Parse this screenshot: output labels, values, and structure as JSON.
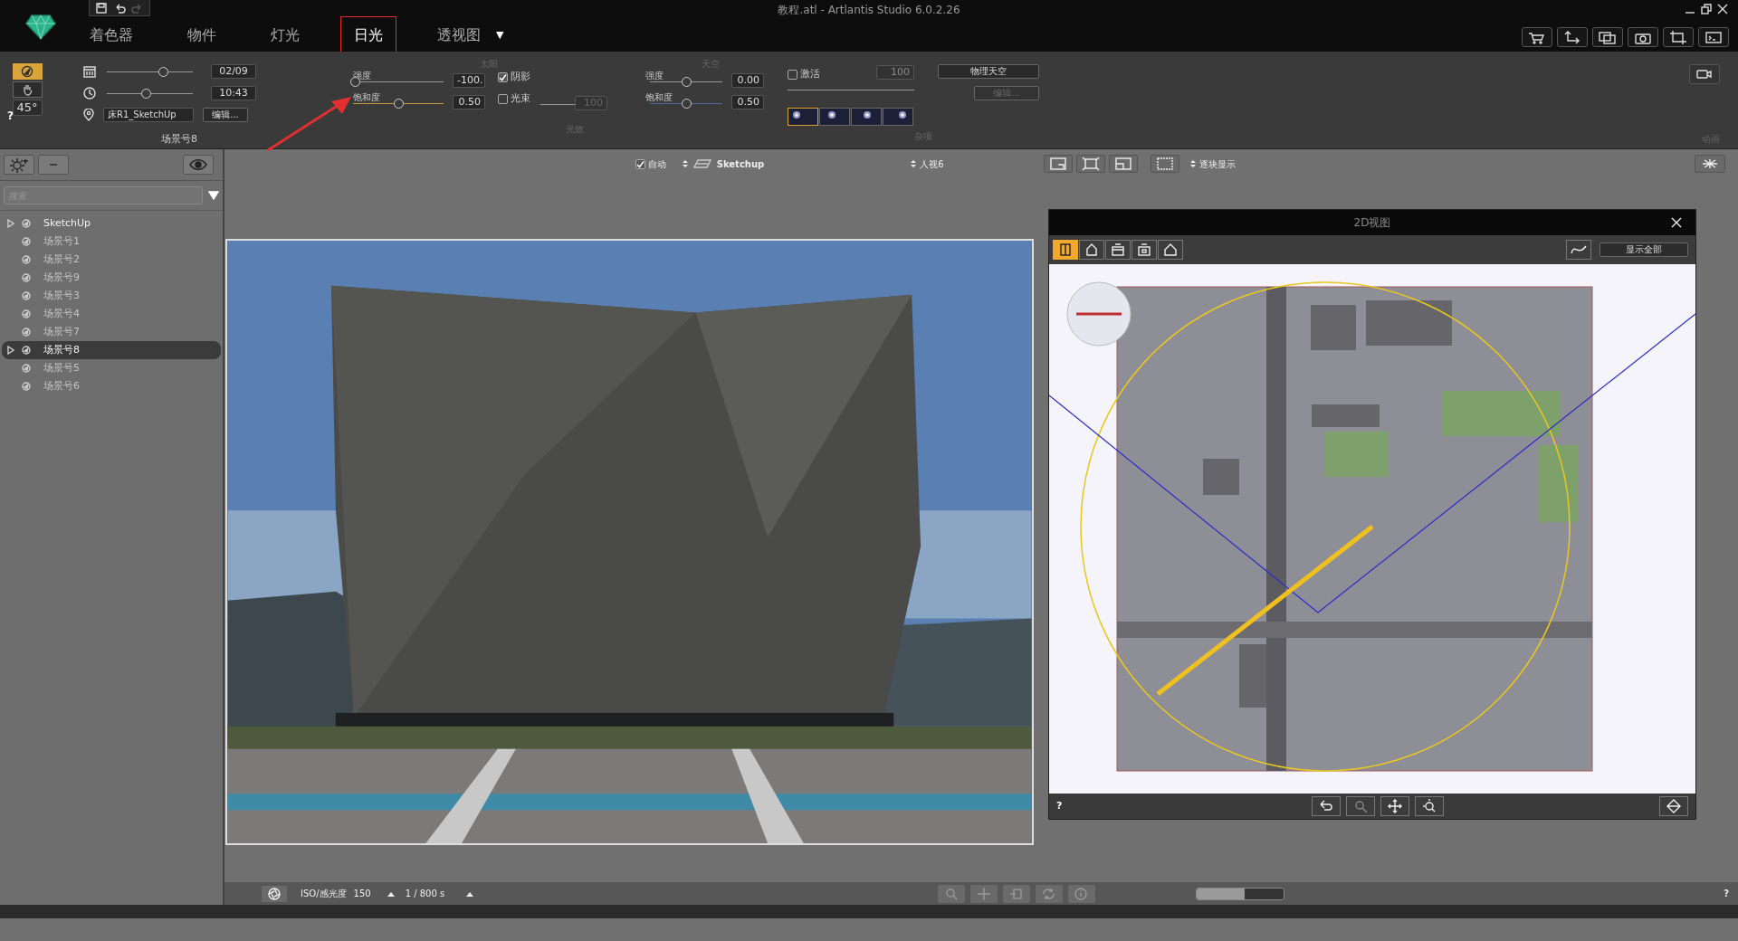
{
  "window": {
    "title": "教程.atl - Artlantis Studio 6.0.2.26"
  },
  "tabs": [
    {
      "label": "着色器",
      "selected": false
    },
    {
      "label": "物件",
      "selected": false
    },
    {
      "label": "灯光",
      "selected": false
    },
    {
      "label": "日光",
      "selected": true
    },
    {
      "label": "透视图",
      "selected": false
    }
  ],
  "tab_menu": "▼",
  "sun_panel": {
    "modes": [
      {
        "kind": "compass",
        "selected": true
      },
      {
        "kind": "hand",
        "selected": false
      }
    ],
    "angle": "45°",
    "date": {
      "level": 0.65,
      "value": "02/09"
    },
    "time": {
      "level": 0.45,
      "value": "10:43"
    },
    "location": {
      "value": "床R1_SketchUp",
      "edit_button": "编辑..."
    },
    "caption": "场景号8",
    "help": "?"
  },
  "sun": {
    "title": "太阳",
    "intensity": {
      "label": "强度",
      "level": 0.02,
      "value": "-100."
    },
    "saturation": {
      "label": "饱和度",
      "level": 0.5,
      "value": "0.50"
    },
    "shadow": {
      "label": "阴影",
      "checked": true
    },
    "beam": {
      "label": "光束",
      "checked": false,
      "value": "100"
    },
    "caption": "光效"
  },
  "sky": {
    "title": "天空",
    "intensity": {
      "label": "强度",
      "level": 0.5,
      "value": "0.00"
    },
    "saturation": {
      "label": "饱和度",
      "level": 0.5,
      "value": "0.50"
    }
  },
  "fog": {
    "label": "激活",
    "checked": false,
    "value": "100",
    "presets": [
      {
        "selected": true
      },
      {
        "selected": false
      },
      {
        "selected": false
      },
      {
        "selected": false
      }
    ],
    "caption": "杂项"
  },
  "sky_mode": {
    "value": "物理天空",
    "edit_button": "编辑..."
  },
  "animation": {
    "caption": "动画"
  },
  "sidebar": {
    "search": {
      "placeholder": "搜索"
    },
    "items": [
      {
        "label": "SketchUp",
        "expandable": true,
        "selected": false,
        "dimmed": false
      },
      {
        "label": "场景号1",
        "expandable": false,
        "selected": false,
        "dimmed": true
      },
      {
        "label": "场景号2",
        "expandable": false,
        "selected": false,
        "dimmed": true
      },
      {
        "label": "场景号9",
        "expandable": false,
        "selected": false,
        "dimmed": true
      },
      {
        "label": "场景号3",
        "expandable": false,
        "selected": false,
        "dimmed": true
      },
      {
        "label": "场景号4",
        "expandable": false,
        "selected": false,
        "dimmed": true
      },
      {
        "label": "场景号7",
        "expandable": false,
        "selected": false,
        "dimmed": true
      },
      {
        "label": "场景号8",
        "expandable": true,
        "selected": true,
        "dimmed": false
      },
      {
        "label": "场景号5",
        "expandable": false,
        "selected": false,
        "dimmed": true
      },
      {
        "label": "场景号6",
        "expandable": false,
        "selected": false,
        "dimmed": true
      }
    ]
  },
  "viewport_toolbar": {
    "auto": {
      "label": "自动",
      "checked": true
    },
    "model": "Sketchup",
    "view": "人视6",
    "render_mode": "逐块显示"
  },
  "view_2d": {
    "title": "2D视图",
    "display": "显示全部",
    "tools": [
      {
        "kind": "split",
        "selected": true
      },
      {
        "kind": "house",
        "selected": false
      },
      {
        "kind": "box",
        "selected": false
      },
      {
        "kind": "box2",
        "selected": false
      },
      {
        "kind": "roof",
        "selected": false
      }
    ],
    "help": "?"
  },
  "bottom_bar": {
    "iso_label": "ISO/感光度",
    "iso": "150",
    "shutter": "1 / 800 s",
    "level": 0.55,
    "help": "?"
  }
}
